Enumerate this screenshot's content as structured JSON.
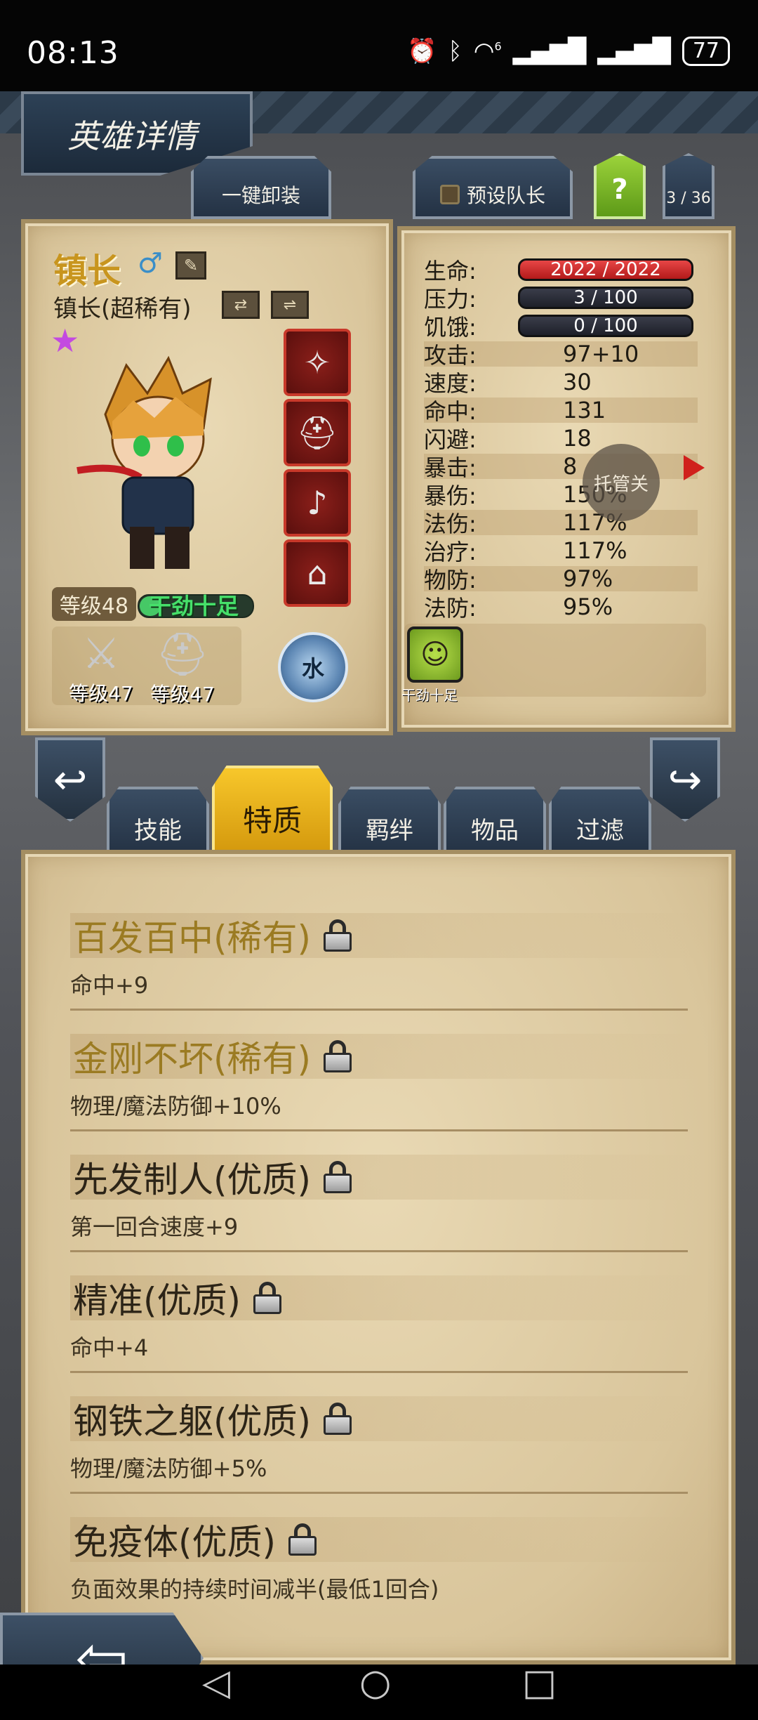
{
  "status_bar": {
    "time": "08:13",
    "icons": [
      "alarm-icon",
      "bluetooth-icon",
      "wifi-icon",
      "signal-icon",
      "signal-icon"
    ],
    "wifi_label": "6",
    "battery": "77"
  },
  "header": {
    "title": "英雄详情",
    "unequip_label": "一键卸装",
    "preset_label": "预设队长",
    "help_label": "?",
    "count_label": "3 / 36"
  },
  "hero": {
    "name": "镇长",
    "class_label": "镇长(超稀有)",
    "level_label": "等级48",
    "status_label": "干劲十足",
    "weapon_level": "等级47",
    "armor_level": "等级47",
    "element": "水",
    "equip_icons": [
      "amulet-icon",
      "helmet-icon",
      "horn-icon",
      "cloak-icon"
    ]
  },
  "stats": {
    "hp": {
      "label": "生命:",
      "value": "2022 / 2022"
    },
    "stress": {
      "label": "压力:",
      "value": "3 / 100"
    },
    "hunger": {
      "label": "饥饿:",
      "value": "0 / 100"
    },
    "rows": [
      {
        "label": "攻击:",
        "value": "97+10"
      },
      {
        "label": "速度:",
        "value": "30"
      },
      {
        "label": "命中:",
        "value": "131"
      },
      {
        "label": "闪避:",
        "value": "18"
      },
      {
        "label": "暴击:",
        "value": "8"
      },
      {
        "label": "暴伤:",
        "value": "150%"
      },
      {
        "label": "法伤:",
        "value": "117%"
      },
      {
        "label": "治疗:",
        "value": "117%"
      },
      {
        "label": "物防:",
        "value": "97%"
      },
      {
        "label": "法防:",
        "value": "95%"
      }
    ],
    "trusteeship_label": "托管关",
    "buff_label": "干劲十足"
  },
  "tabs": [
    "技能",
    "特质",
    "羁绊",
    "物品",
    "过滤"
  ],
  "active_tab": "特质",
  "traits": [
    {
      "name": "百发百中(稀有)",
      "desc": "命中+9",
      "tier": "rare"
    },
    {
      "name": "金刚不坏(稀有)",
      "desc": "物理/魔法防御+10%",
      "tier": "rare"
    },
    {
      "name": "先发制人(优质)",
      "desc": "第一回合速度+9",
      "tier": "fine"
    },
    {
      "name": "精准(优质)",
      "desc": "命中+4",
      "tier": "fine"
    },
    {
      "name": "钢铁之躯(优质)",
      "desc": "物理/魔法防御+5%",
      "tier": "fine"
    },
    {
      "name": "免疫体(优质)",
      "desc": "负面效果的持续时间减半(最低1回合)",
      "tier": "fine"
    }
  ],
  "colors": {
    "accent_gold": "#d59a0e",
    "hp_red": "#e74646",
    "parchment": "#e9d9b4",
    "rare_text": "#9b7b22"
  }
}
